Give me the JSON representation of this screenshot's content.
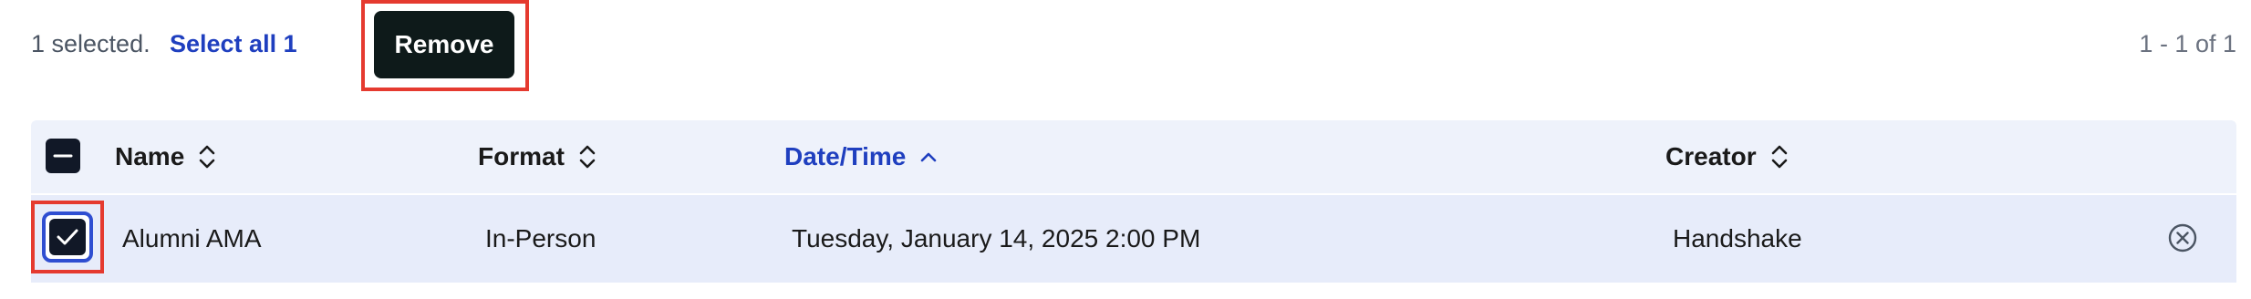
{
  "selection_bar": {
    "selected_text": "1 selected.",
    "select_all_label": "Select all 1",
    "remove_label": "Remove",
    "pagination_text": "1 - 1 of 1"
  },
  "table": {
    "headers": [
      {
        "label": "Name",
        "sort": "unsorted"
      },
      {
        "label": "Format",
        "sort": "unsorted"
      },
      {
        "label": "Date/Time",
        "sort": "ascending"
      },
      {
        "label": "Creator",
        "sort": "unsorted"
      }
    ],
    "rows": [
      {
        "selected": true,
        "name": "Alumni AMA",
        "format": "In-Person",
        "datetime": "Tuesday, January 14, 2025 2:00 PM",
        "creator": "Handshake"
      }
    ]
  },
  "colors": {
    "accent": "#1f3fbf",
    "highlight": "#e53a2f",
    "button_bg": "#0e1a1a"
  },
  "icons": {
    "header_checkbox": "indeterminate-checkbox-icon",
    "sort_unsorted": "sort-updown-icon",
    "sort_ascending": "chevron-up-icon",
    "row_checkbox": "checkmark-icon",
    "row_remove": "remove-circle-icon"
  }
}
